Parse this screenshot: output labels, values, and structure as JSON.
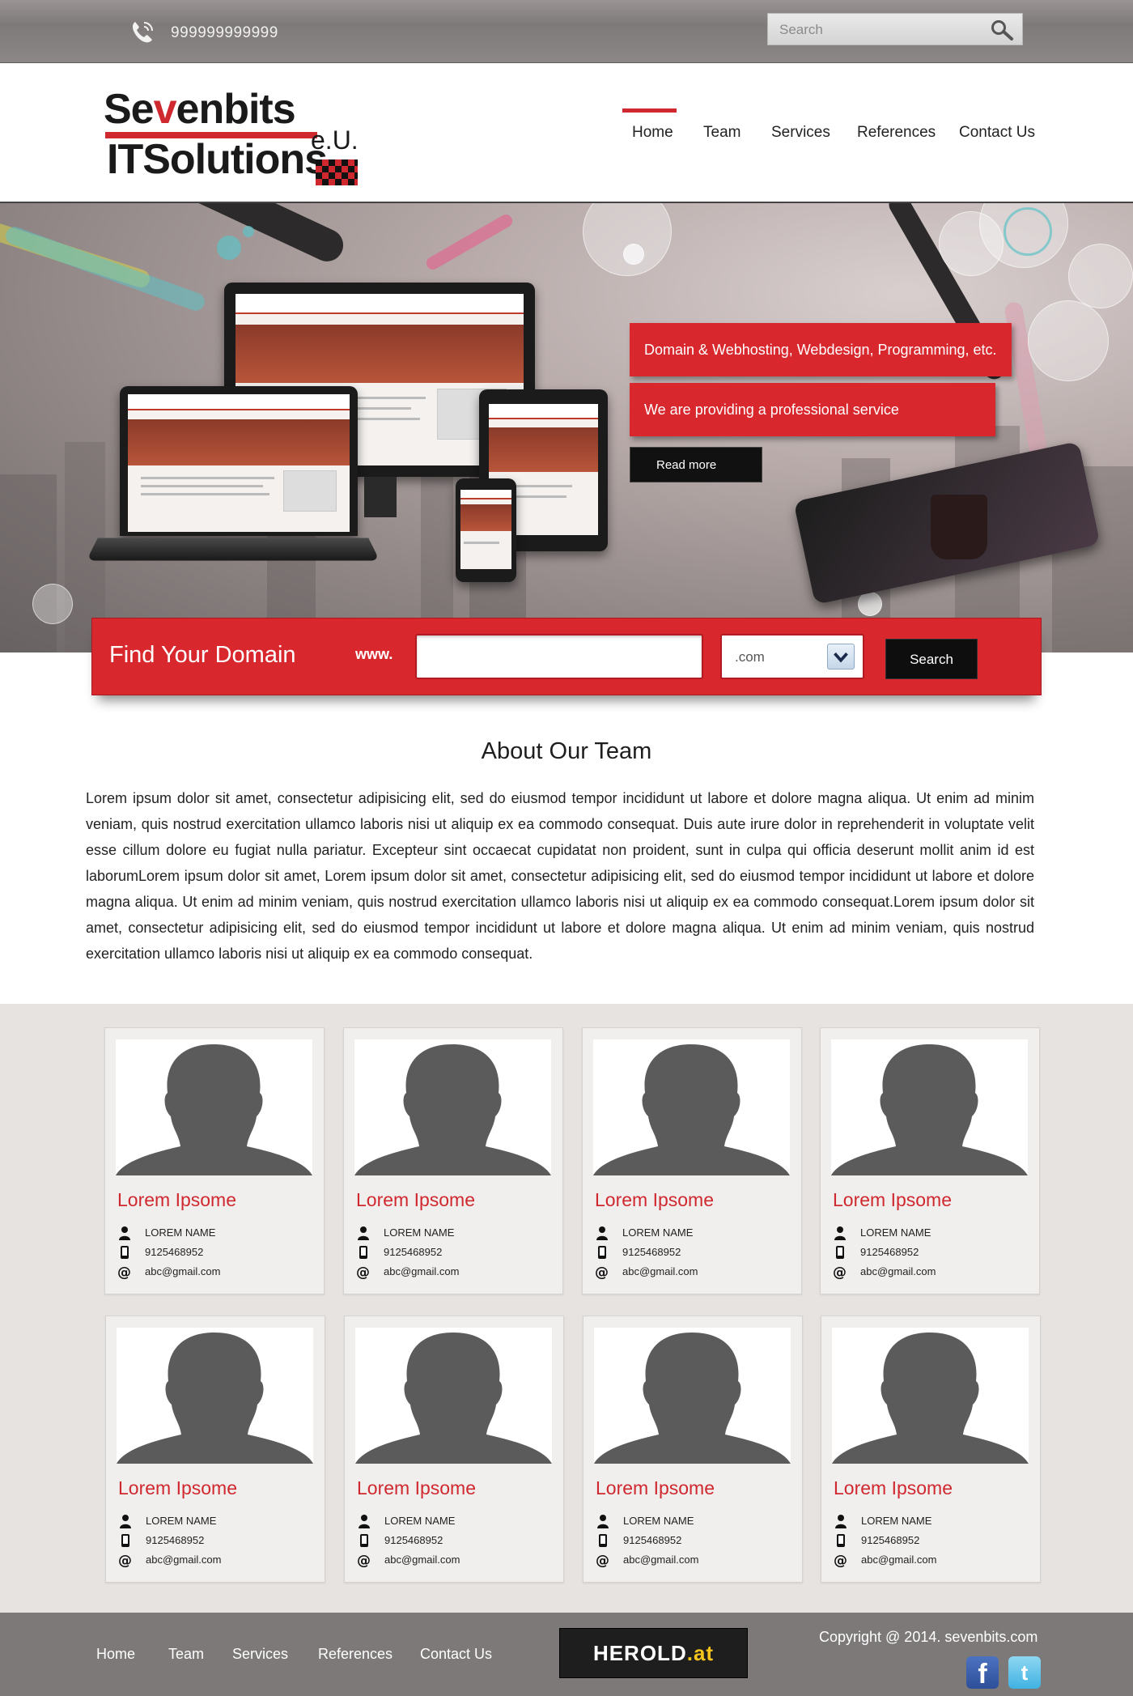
{
  "topbar": {
    "phone": "999999999999",
    "search_placeholder": "Search"
  },
  "logo": {
    "line1_a": "Se",
    "line1_check": "v",
    "line1_b": "enbits",
    "line2": "ITSolutions",
    "suffix": "e.U."
  },
  "nav": {
    "items": [
      "Home",
      "Team",
      "Services",
      "References",
      "Contact Us"
    ],
    "active": "Home"
  },
  "hero": {
    "slogan1": "Domain & Webhosting, Webdesign, Programming, etc.",
    "slogan2": "We are providing  a professional service",
    "read_more": "Read more"
  },
  "domain": {
    "title": "Find Your Domain",
    "prefix": "www.",
    "input_value": "",
    "tld": ".com",
    "button": "Search"
  },
  "about": {
    "title": "About Our Team",
    "text": "Lorem ipsum dolor sit amet, consectetur adipisicing elit, sed do eiusmod tempor incididunt ut labore et dolore magna aliqua. Ut enim ad minim veniam, quis nostrud exercitation ullamco laboris nisi ut aliquip ex ea commodo consequat. Duis aute irure dolor in reprehenderit in voluptate velit esse cillum dolore eu fugiat nulla pariatur. Excepteur sint occaecat cupidatat non proident, sunt in culpa qui officia deserunt mollit anim id est laborumLorem ipsum dolor sit amet, Lorem ipsum dolor sit amet, consectetur adipisicing elit, sed do eiusmod tempor incididunt ut labore et dolore magna aliqua. Ut enim ad minim veniam, quis nostrud exercitation ullamco laboris nisi ut aliquip ex ea commodo consequat.Lorem ipsum dolor sit amet, consectetur adipisicing elit, sed do eiusmod tempor incididunt ut labore et dolore magna aliqua. Ut enim ad minim veniam, quis nostrud exercitation ullamco laboris nisi ut aliquip ex ea commodo consequat."
  },
  "team": {
    "members": [
      {
        "title": "Lorem Ipsome",
        "name": "LOREM NAME",
        "phone": "9125468952",
        "email": "abc@gmail.com"
      },
      {
        "title": "Lorem Ipsome",
        "name": "LOREM NAME",
        "phone": "9125468952",
        "email": "abc@gmail.com"
      },
      {
        "title": "Lorem Ipsome",
        "name": "LOREM NAME",
        "phone": "9125468952",
        "email": "abc@gmail.com"
      },
      {
        "title": "Lorem Ipsome",
        "name": "LOREM NAME",
        "phone": "9125468952",
        "email": "abc@gmail.com"
      },
      {
        "title": "Lorem Ipsome",
        "name": "LOREM NAME",
        "phone": "9125468952",
        "email": "abc@gmail.com"
      },
      {
        "title": "Lorem Ipsome",
        "name": "LOREM NAME",
        "phone": "9125468952",
        "email": "abc@gmail.com"
      },
      {
        "title": "Lorem Ipsome",
        "name": "LOREM NAME",
        "phone": "9125468952",
        "email": "abc@gmail.com"
      },
      {
        "title": "Lorem Ipsome",
        "name": "LOREM NAME",
        "phone": "9125468952",
        "email": "abc@gmail.com"
      }
    ]
  },
  "footer": {
    "nav": [
      "Home",
      "Team",
      "Services",
      "References",
      "Contact Us"
    ],
    "herold_a": "HEROLD",
    "herold_b": ".at",
    "copyright": "Copyright @ 2014. sevenbits.com",
    "social_fb": "f",
    "social_tw": "t"
  },
  "colors": {
    "accent": "#d8272d",
    "topbar": "#8a8585",
    "footer": "#7d7979",
    "team_bg": "#e6e3e1"
  },
  "icons": [
    "phone-icon",
    "search-icon",
    "person-icon",
    "mobile-icon",
    "at-icon",
    "chevron-down-icon",
    "facebook-icon",
    "twitter-icon"
  ]
}
